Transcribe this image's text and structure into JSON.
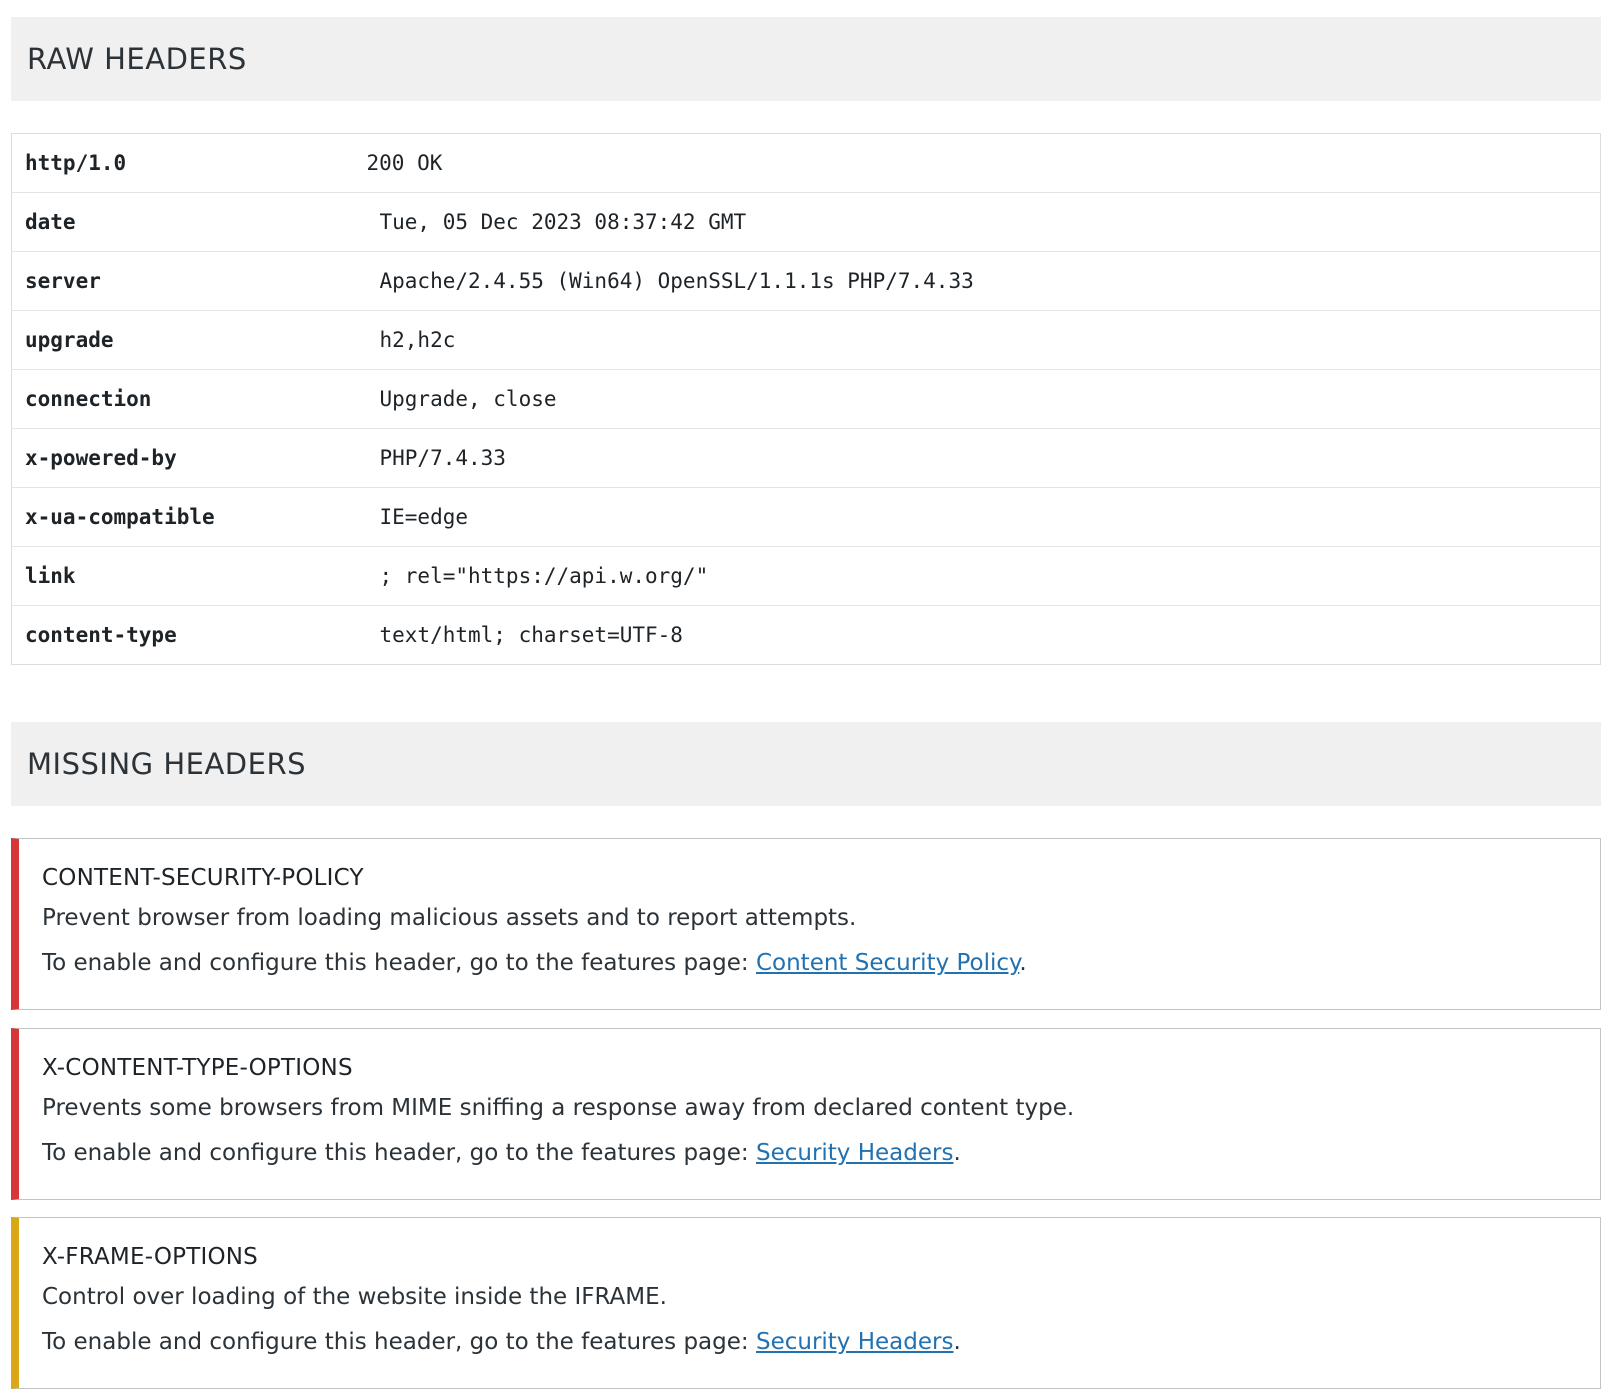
{
  "raw_headers": {
    "title": "RAW HEADERS",
    "rows": [
      {
        "key": "http/1.0",
        "value": "200 OK"
      },
      {
        "key": "date",
        "value": "Tue, 05 Dec 2023 08:37:42 GMT"
      },
      {
        "key": "server",
        "value": "Apache/2.4.55 (Win64) OpenSSL/1.1.1s PHP/7.4.33"
      },
      {
        "key": "upgrade",
        "value": "h2,h2c"
      },
      {
        "key": "connection",
        "value": "Upgrade, close"
      },
      {
        "key": "x-powered-by",
        "value": "PHP/7.4.33"
      },
      {
        "key": "x-ua-compatible",
        "value": "IE=edge"
      },
      {
        "key": "link",
        "value": "; rel=\"https://api.w.org/\""
      },
      {
        "key": "content-type",
        "value": "text/html; charset=UTF-8"
      }
    ]
  },
  "missing_headers": {
    "title": "MISSING HEADERS",
    "items": [
      {
        "name": "CONTENT-SECURITY-POLICY",
        "description": "Prevent browser from loading malicious assets and to report attempts.",
        "enable_text": "To enable and configure this header, go to the features page: ",
        "link_text": "Content Security Policy",
        "severity_color": "#d63638"
      },
      {
        "name": "X-CONTENT-TYPE-OPTIONS",
        "description": "Prevents some browsers from MIME sniffing a response away from declared content type.",
        "enable_text": "To enable and configure this header, go to the features page: ",
        "link_text": "Security Headers",
        "severity_color": "#d63638"
      },
      {
        "name": "X-FRAME-OPTIONS",
        "description": "Control over loading of the website inside the IFRAME.",
        "enable_text": "To enable and configure this header, go to the features page: ",
        "link_text": "Security Headers",
        "severity_color": "#dba617"
      }
    ]
  },
  "colors": {
    "header_bg": "#f0f0f0",
    "link": "#2271b1",
    "error": "#d63638",
    "warning": "#dba617"
  }
}
